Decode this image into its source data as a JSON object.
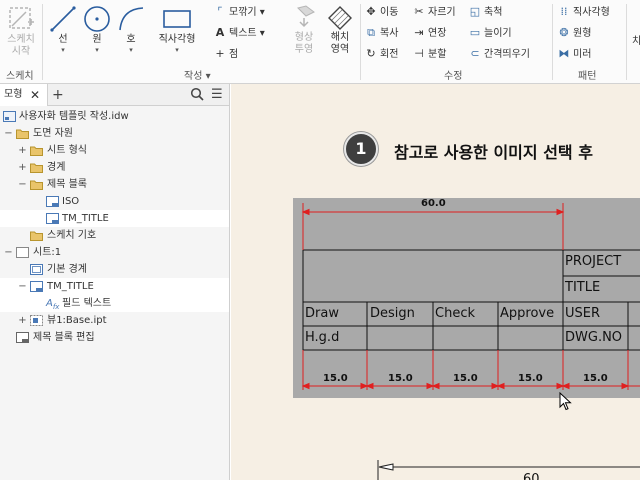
{
  "ribbon": {
    "sketch_start": "스케치\n시작",
    "sketch_start_l1": "스케치",
    "sketch_start_l2": "시작",
    "sketch_panel": "스케치",
    "line": "선",
    "circle": "원",
    "arc": "호",
    "rectangle": "직사각형",
    "fillet": "모깎기",
    "text": "텍스트",
    "point": "점",
    "project_l1": "형상",
    "project_l2": "투영",
    "hatch_l1": "해치",
    "hatch_l2": "영역",
    "create_panel": "작성",
    "move": "이동",
    "trim": "자르기",
    "scale": "축척",
    "copy": "복사",
    "extend": "연장",
    "stretch": "늘이기",
    "rotate": "회전",
    "split": "분할",
    "offset": "간격띄우기",
    "modify_panel": "수정",
    "rect_pattern": "직사각형",
    "circ_pattern": "원형",
    "mirror": "미러",
    "pattern_panel": "패턴",
    "cut_label": "치"
  },
  "browser": {
    "tab_label": "모형",
    "tab_close": "✕",
    "add_tab": "+",
    "menu_glyph": "☰",
    "tree": [
      {
        "label": "사용자화 템플릿 작성.idw",
        "expander": ""
      },
      {
        "label": "도면 자원",
        "expander": "−"
      },
      {
        "label": "시트 형식",
        "expander": "+"
      },
      {
        "label": "경계",
        "expander": "+"
      },
      {
        "label": "제목 블록",
        "expander": "−"
      },
      {
        "label": "ISO",
        "expander": ""
      },
      {
        "label": "TM_TITLE",
        "expander": ""
      },
      {
        "label": "스케치 기호",
        "expander": ""
      },
      {
        "label": "시트:1",
        "expander": "−"
      },
      {
        "label": "기본 경계",
        "expander": ""
      },
      {
        "label": "TM_TITLE",
        "expander": "−"
      },
      {
        "label": "필드 텍스트",
        "expander": ""
      },
      {
        "label": "뷰1:Base.ipt",
        "expander": "+"
      },
      {
        "label": "제목 블록 편집",
        "expander": ""
      }
    ]
  },
  "canvas": {
    "step_number": "1",
    "step_text": "참고로 사용한 이미지 선택 후",
    "title_block": {
      "top_dim": "60.0",
      "project": "PROJECT",
      "title": "TITLE",
      "headers": [
        "Draw",
        "Design",
        "Check",
        "Approve",
        "USER"
      ],
      "values": [
        "H.g.d",
        "DWG.NO"
      ],
      "bottom_dims": [
        "15.0",
        "15.0",
        "15.0",
        "15.0",
        "15.0"
      ]
    },
    "lower_dim": "60"
  }
}
